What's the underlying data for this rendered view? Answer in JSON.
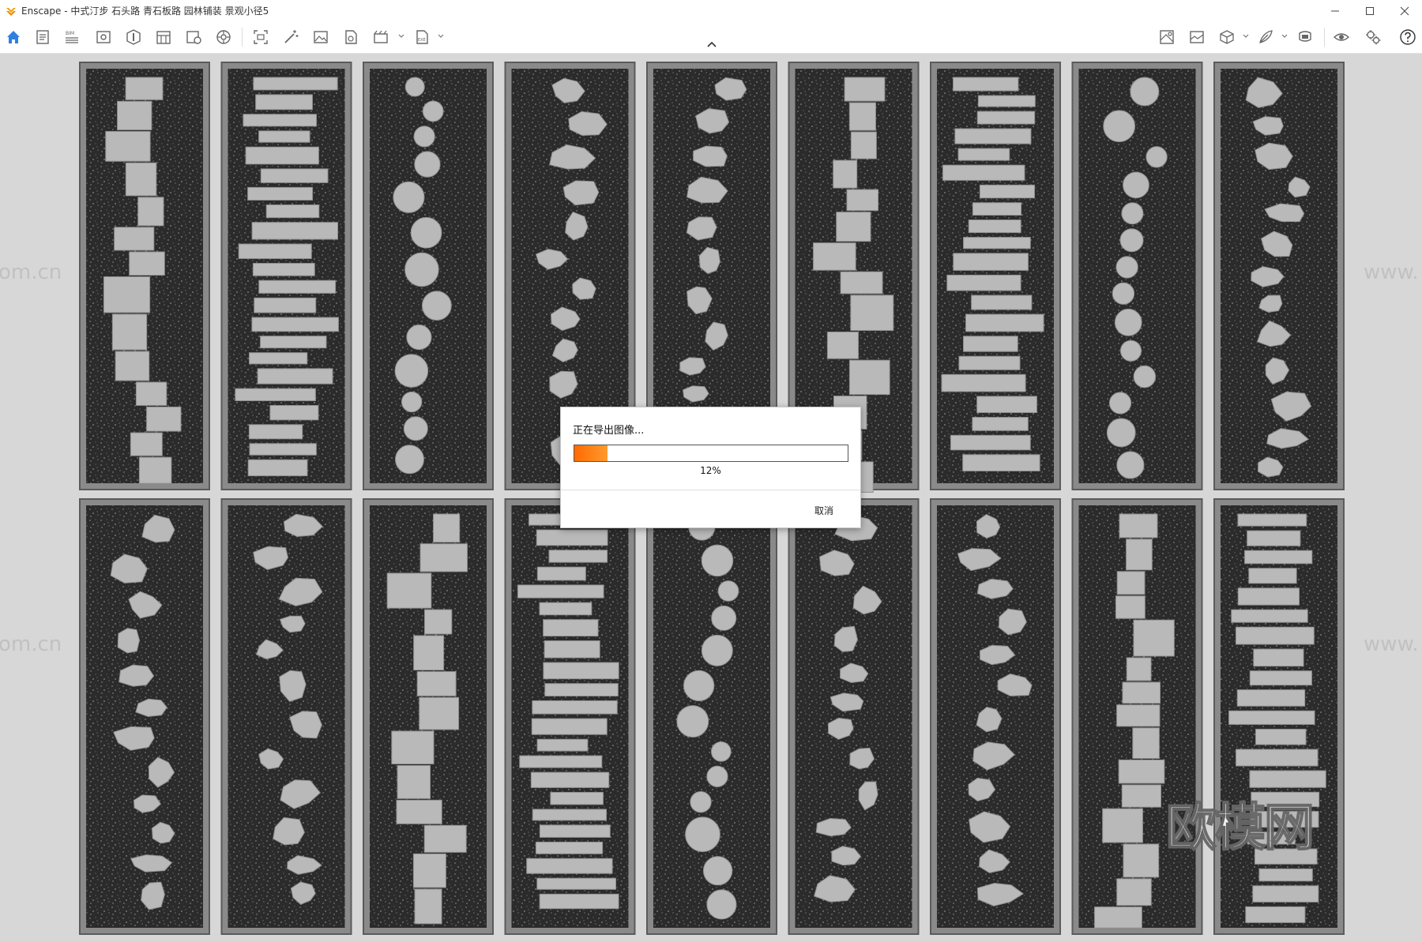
{
  "window": {
    "app_name": "Enscape",
    "title": "Enscape - 中式汀步 石头路 青石板路 园林铺装 景观小径5",
    "controls": [
      "minimize",
      "maximize",
      "close"
    ]
  },
  "toolbar": {
    "left_icons": [
      "home-icon",
      "document-icon",
      "bim-icon",
      "view-icon",
      "navigator-icon",
      "sections-icon",
      "info-icon",
      "settings-wheel-icon",
      "screenshot-icon",
      "magic-wand-icon",
      "image-icon",
      "batch-render-icon",
      "video-icon",
      "export-icon"
    ],
    "right_icons": [
      "map-icon",
      "image-view-icon",
      "asset-box-icon",
      "feather-icon",
      "vr-headset-icon",
      "eye-icon",
      "gear-settings-icon",
      "help-icon"
    ],
    "bim_label": "BIM",
    "export_label": "EXE"
  },
  "watermark": {
    "brand": "欧模网",
    "side_left": "om.cn",
    "side_right": "www."
  },
  "export_dialog": {
    "title": "正在导出图像...",
    "progress": 0.12,
    "progress_text": "12%",
    "cancel_label": "取消",
    "accent_color": "#ff7a10"
  }
}
